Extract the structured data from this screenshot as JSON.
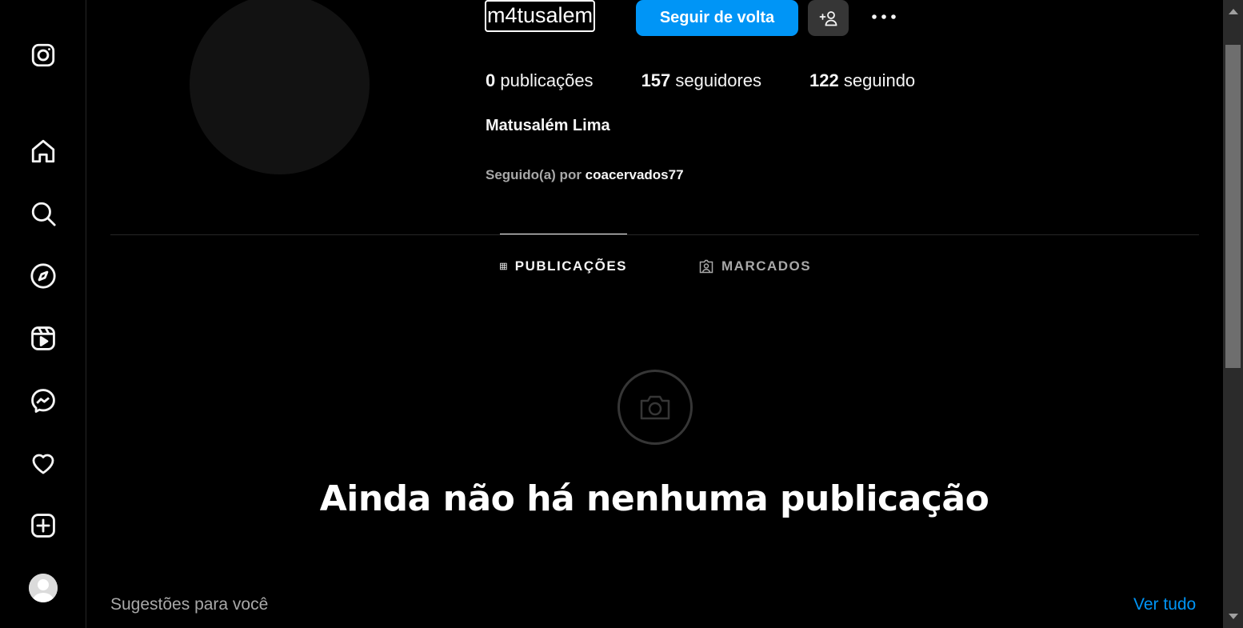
{
  "sidebar": {
    "items": [
      {
        "name": "instagram-logo-icon"
      },
      {
        "name": "home-icon"
      },
      {
        "name": "search-icon"
      },
      {
        "name": "explore-icon"
      },
      {
        "name": "reels-icon"
      },
      {
        "name": "messenger-icon"
      },
      {
        "name": "notifications-heart-icon"
      },
      {
        "name": "create-icon"
      },
      {
        "name": "profile-avatar"
      }
    ]
  },
  "profile": {
    "username": "m4tusalem",
    "follow_label": "Seguir de volta",
    "stats": {
      "posts_count": "0",
      "posts_label": " publicações",
      "followers_count": "157",
      "followers_label": " seguidores",
      "following_count": "122",
      "following_label": " seguindo"
    },
    "full_name": "Matusalém Lima",
    "followed_by_prefix": "Seguido(a) por ",
    "followed_by_user": "coacervados77"
  },
  "tabs": {
    "posts": "PUBLICAÇÕES",
    "tagged": "MARCADOS"
  },
  "empty": {
    "title": "Ainda não há nenhuma publicação"
  },
  "suggestions": {
    "title": "Sugestões para você",
    "see_all": "Ver tudo"
  },
  "colors": {
    "accent": "#0095f6",
    "background": "#000000",
    "secondary_text": "#a8a8a8"
  }
}
